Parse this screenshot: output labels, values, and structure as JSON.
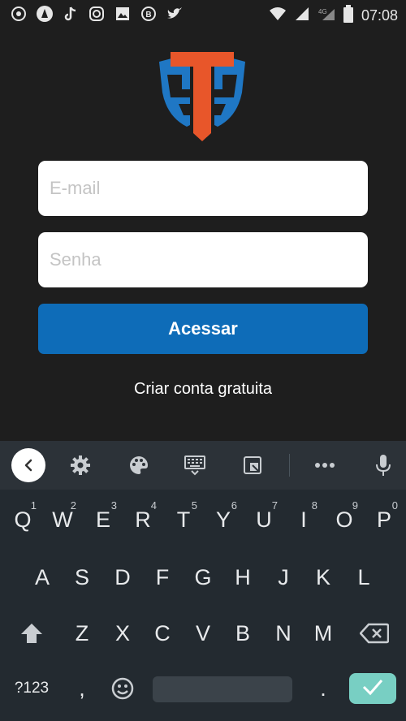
{
  "status_bar": {
    "time": "07:08",
    "left_icons": [
      "whatsapp-icon",
      "app-icon",
      "tiktok-icon",
      "instagram-icon",
      "gallery-icon",
      "b-app-icon",
      "twitter-icon"
    ],
    "right_icons": [
      "wifi-icon",
      "signal-icon",
      "signal-4g-icon",
      "battery-icon"
    ]
  },
  "login": {
    "email_placeholder": "E-mail",
    "password_placeholder": "Senha",
    "submit_label": "Acessar",
    "create_account_label": "Criar conta gratuita"
  },
  "colors": {
    "background": "#1e1e1e",
    "primary_button": "#0e6cb8",
    "logo_blue": "#1f77c4",
    "logo_orange": "#e8562a",
    "enter_key": "#78cfc3"
  },
  "keyboard": {
    "toolbar_icons": [
      "back-icon",
      "settings-icon",
      "palette-icon",
      "keyboard-icon",
      "clipboard-icon",
      "more-icon",
      "mic-icon"
    ],
    "row1": [
      {
        "k": "Q",
        "h": "1"
      },
      {
        "k": "W",
        "h": "2"
      },
      {
        "k": "E",
        "h": "3"
      },
      {
        "k": "R",
        "h": "4"
      },
      {
        "k": "T",
        "h": "5"
      },
      {
        "k": "Y",
        "h": "6"
      },
      {
        "k": "U",
        "h": "7"
      },
      {
        "k": "I",
        "h": "8"
      },
      {
        "k": "O",
        "h": "9"
      },
      {
        "k": "P",
        "h": "0"
      }
    ],
    "row2": [
      "A",
      "S",
      "D",
      "F",
      "G",
      "H",
      "J",
      "K",
      "L"
    ],
    "row3": [
      "Z",
      "X",
      "C",
      "V",
      "B",
      "N",
      "M"
    ],
    "sym_label": "?123",
    "comma": ",",
    "period": "."
  }
}
